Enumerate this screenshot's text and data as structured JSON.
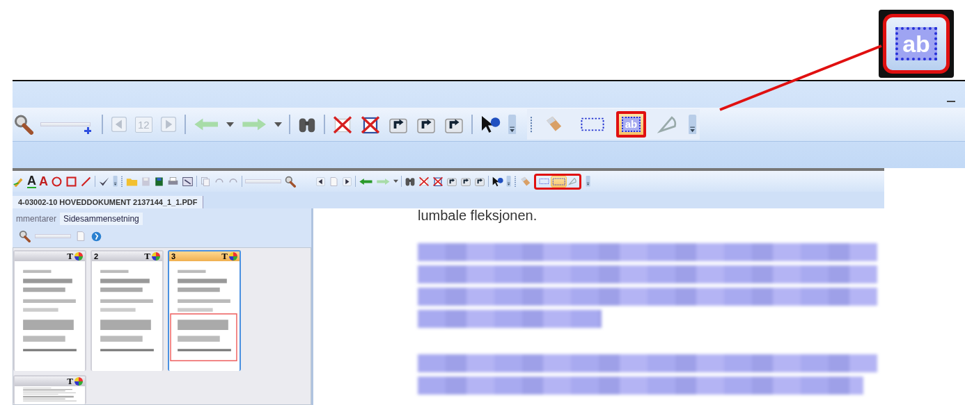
{
  "callout": {
    "label": "ab"
  },
  "upper_toolbar": {
    "page_number": {
      "text": "12",
      "disabled": true
    },
    "selected_tool_label": "ab",
    "zoom_slider": {
      "level": 1
    },
    "tools": [
      {
        "selected": false
      },
      {
        "selected": false
      },
      {
        "selected": true
      },
      {
        "selected": false
      }
    ]
  },
  "lower_toolbar": {
    "zoom_slider": {
      "level": 1
    },
    "text_tools": [
      {
        "glyph": "A"
      },
      {
        "glyph": "A"
      }
    ],
    "tools": [
      {
        "selected": false
      },
      {
        "selected": false
      },
      {
        "selected": true
      },
      {
        "selected": false
      }
    ]
  },
  "document_tab": {
    "title": "4-03002-10 HOVEDDOKUMENT 2137144_1_1.PDF",
    "selected": true
  },
  "panel_zoom_slider": {
    "level": 1
  },
  "panel_tabs": [
    {
      "label": "mmentarer",
      "selected": false
    },
    {
      "label": "Sidesammensetning",
      "selected": true
    }
  ],
  "thumbnails": [
    {
      "mark": "T",
      "selected": false
    },
    {
      "number": "2",
      "mark": "T",
      "selected": false
    },
    {
      "number": "3",
      "mark": "T",
      "selected": true
    },
    {
      "mark": "T",
      "selected": false
    }
  ],
  "document": {
    "visible_line": "lumbale fleksjonen."
  }
}
